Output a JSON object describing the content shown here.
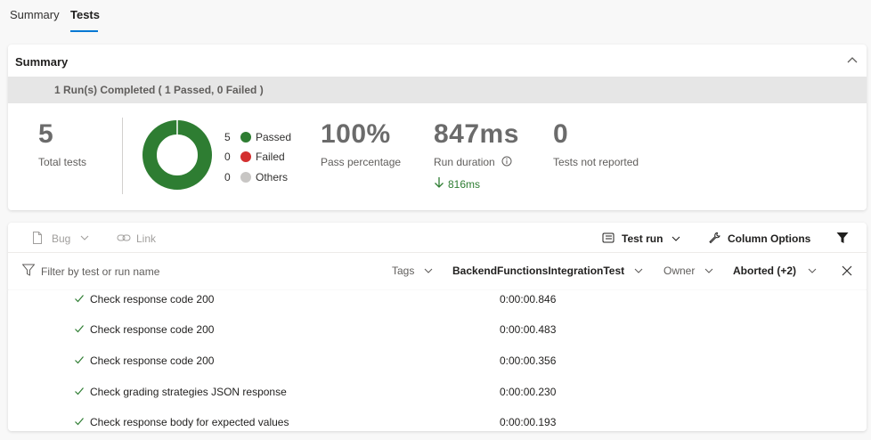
{
  "tabs": [
    {
      "label": "Summary",
      "active": false
    },
    {
      "label": "Tests",
      "active": true
    }
  ],
  "summary": {
    "title": "Summary",
    "runs_text": "1 Run(s) Completed ( 1 Passed, 0 Failed )",
    "total_tests": {
      "value": "5",
      "label": "Total tests"
    },
    "legend": [
      {
        "count": "5",
        "label": "Passed",
        "color": "#2e7d32"
      },
      {
        "count": "0",
        "label": "Failed",
        "color": "#d32f2f"
      },
      {
        "count": "0",
        "label": "Others",
        "color": "#c8c6c4"
      }
    ],
    "pass_pct": {
      "value": "100%",
      "label": "Pass percentage"
    },
    "run_duration": {
      "value": "847ms",
      "label": "Run duration",
      "delta": "816ms"
    },
    "not_reported": {
      "value": "0",
      "label": "Tests not reported"
    }
  },
  "toolbar": {
    "bug": "Bug",
    "link": "Link",
    "test_run": "Test run",
    "column_options": "Column Options"
  },
  "filter": {
    "placeholder": "Filter by test or run name",
    "tags": "Tags",
    "run_name": "BackendFunctionsIntegrationTest",
    "owner": "Owner",
    "outcome": "Aborted (+2)"
  },
  "results": [
    {
      "name": "Check response code 200",
      "duration": "0:00:00.846"
    },
    {
      "name": "Check response code 200",
      "duration": "0:00:00.483"
    },
    {
      "name": "Check response code 200",
      "duration": "0:00:00.356"
    },
    {
      "name": "Check grading strategies JSON response",
      "duration": "0:00:00.230"
    },
    {
      "name": "Check response body for expected values",
      "duration": "0:00:00.193"
    }
  ],
  "colors": {
    "accent": "#0078d4",
    "passed": "#2e7d32",
    "failed": "#d32f2f",
    "delta_green": "#2e7d32"
  }
}
